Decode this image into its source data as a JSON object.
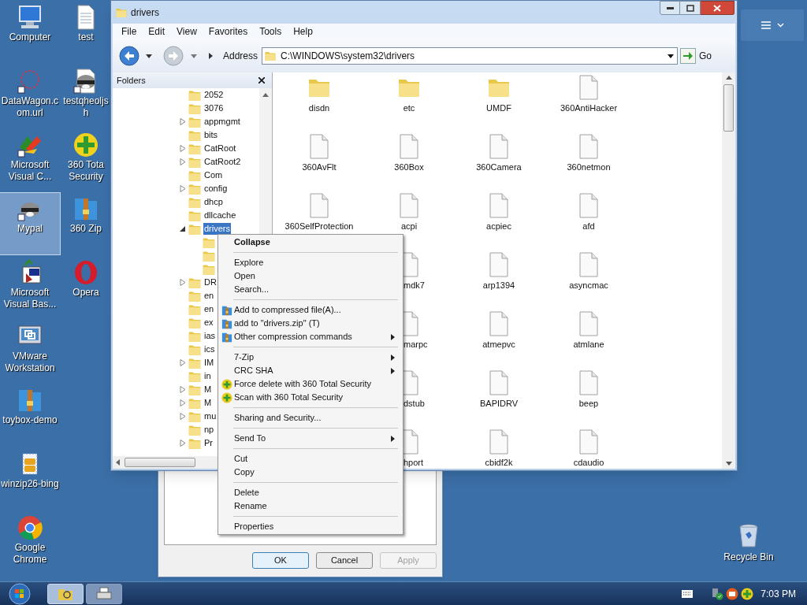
{
  "desktop_icons": [
    {
      "label": "Computer",
      "kind": "computer",
      "selected": false
    },
    {
      "label": "DataWagon.com.url",
      "kind": "web-link",
      "selected": false
    },
    {
      "label": "Microsoft Visual C...",
      "kind": "colorful-app",
      "selected": false
    },
    {
      "label": "Mypal",
      "kind": "raccoon",
      "selected": true
    },
    {
      "label": "Microsoft Visual Bas...",
      "kind": "vb-setup",
      "selected": false
    },
    {
      "label": "VMware Workstation",
      "kind": "vmware",
      "selected": false
    },
    {
      "label": "toybox-demo",
      "kind": "zip-folder",
      "selected": false
    },
    {
      "label": "winzip26-bing",
      "kind": "winzip",
      "selected": false
    },
    {
      "label": "Google Chrome",
      "kind": "chrome",
      "selected": false
    },
    {
      "label": "test",
      "kind": "text-file",
      "selected": false
    },
    {
      "label": "testqheoljsh",
      "kind": "raccoon-file",
      "selected": false
    },
    {
      "label": "360 Tota Security",
      "kind": "plus-shield",
      "selected": false
    },
    {
      "label": "360 Zip",
      "kind": "zip-folder",
      "selected": false
    },
    {
      "label": "Opera",
      "kind": "opera",
      "selected": false
    }
  ],
  "recycle_bin": {
    "label": "Recycle Bin"
  },
  "dialog": {
    "buttons": [
      {
        "label": "OK",
        "default": true,
        "disabled": false
      },
      {
        "label": "Cancel",
        "default": false,
        "disabled": false
      },
      {
        "label": "Apply",
        "default": false,
        "disabled": true
      }
    ]
  },
  "explorer": {
    "title": "drivers",
    "menu": [
      "File",
      "Edit",
      "View",
      "Favorites",
      "Tools",
      "Help"
    ],
    "address_label": "Address",
    "address": "C:\\WINDOWS\\system32\\drivers",
    "go": "Go",
    "folders_title": "Folders",
    "tree": [
      {
        "label": "2052",
        "expandable": false,
        "selected": false
      },
      {
        "label": "3076",
        "expandable": false,
        "selected": false
      },
      {
        "label": "appmgmt",
        "expandable": true,
        "expanded": false,
        "selected": false
      },
      {
        "label": "bits",
        "expandable": false,
        "selected": false
      },
      {
        "label": "CatRoot",
        "expandable": true,
        "expanded": false,
        "selected": false
      },
      {
        "label": "CatRoot2",
        "expandable": true,
        "expanded": false,
        "selected": false
      },
      {
        "label": "Com",
        "expandable": false,
        "selected": false
      },
      {
        "label": "config",
        "expandable": true,
        "expanded": false,
        "selected": false
      },
      {
        "label": "dhcp",
        "expandable": false,
        "selected": false
      },
      {
        "label": "dllcache",
        "expandable": false,
        "selected": false
      },
      {
        "label": "drivers",
        "expandable": true,
        "expanded": true,
        "selected": true,
        "children": [
          {
            "expandable": false,
            "selected": false
          },
          {
            "expandable": false,
            "selected": false
          },
          {
            "expandable": false,
            "selected": false
          }
        ]
      },
      {
        "label": "DR",
        "expandable": true,
        "expanded": false,
        "selected": false
      },
      {
        "label": "en",
        "expandable": false,
        "selected": false
      },
      {
        "label": "en",
        "expandable": false,
        "selected": false
      },
      {
        "label": "ex",
        "expandable": false,
        "selected": false
      },
      {
        "label": "ias",
        "expandable": false,
        "selected": false
      },
      {
        "label": "ics",
        "expandable": false,
        "selected": false
      },
      {
        "label": "IM",
        "expandable": true,
        "expanded": false,
        "selected": false
      },
      {
        "label": "in",
        "expandable": false,
        "selected": false
      },
      {
        "label": "M",
        "expandable": true,
        "expanded": false,
        "selected": false
      },
      {
        "label": "M",
        "expandable": true,
        "expanded": false,
        "selected": false
      },
      {
        "label": "mu",
        "expandable": true,
        "expanded": false,
        "selected": false
      },
      {
        "label": "np",
        "expandable": false,
        "selected": false
      },
      {
        "label": "Pr",
        "expandable": true,
        "expanded": false,
        "selected": false
      }
    ],
    "file_rows": [
      [
        {
          "label": "disdn",
          "kind": "folder",
          "clipped": false
        },
        {
          "label": "etc",
          "kind": "folder",
          "clipped": false
        },
        {
          "label": "UMDF",
          "kind": "folder",
          "clipped": false
        },
        {
          "label": "360AntiHacker",
          "kind": "file",
          "clipped": false
        }
      ],
      [
        {
          "label": "360AvFlt",
          "kind": "file",
          "clipped": false
        },
        {
          "label": "360Box",
          "kind": "file",
          "clipped": false
        },
        {
          "label": "360Camera",
          "kind": "file",
          "clipped": false
        },
        {
          "label": "360netmon",
          "kind": "file",
          "clipped": false
        }
      ],
      [
        {
          "label": "360SelfProtection",
          "kind": "file",
          "clipped": false
        },
        {
          "label": "acpi",
          "kind": "file",
          "clipped": false
        },
        {
          "label": "acpiec",
          "kind": "file",
          "clipped": false
        },
        {
          "label": "afd",
          "kind": "file",
          "clipped": false
        }
      ],
      [
        {
          "label": "mdk7",
          "kind": "file",
          "clipped": true
        },
        {
          "label": "arp1394",
          "kind": "file",
          "clipped": false
        },
        {
          "label": "asyncmac",
          "kind": "file",
          "clipped": false
        }
      ],
      [
        {
          "label": "marpc",
          "kind": "file",
          "clipped": true
        },
        {
          "label": "atmepvc",
          "kind": "file",
          "clipped": false
        },
        {
          "label": "atmlane",
          "kind": "file",
          "clipped": false
        }
      ],
      [
        {
          "label": "dstub",
          "kind": "file",
          "clipped": true
        },
        {
          "label": "BAPIDRV",
          "kind": "file",
          "clipped": false
        },
        {
          "label": "beep",
          "kind": "file",
          "clipped": false
        }
      ],
      [
        {
          "label": "hport",
          "kind": "file",
          "clipped": true
        },
        {
          "label": "cbidf2k",
          "kind": "file",
          "clipped": false
        },
        {
          "label": "cdaudio",
          "kind": "file",
          "clipped": false
        }
      ]
    ]
  },
  "context_menu": [
    {
      "kind": "item",
      "label": "Collapse",
      "default": true,
      "submenu": false
    },
    {
      "kind": "separator"
    },
    {
      "kind": "item",
      "label": "Explore",
      "default": false,
      "submenu": false
    },
    {
      "kind": "item",
      "label": "Open",
      "default": false,
      "submenu": false
    },
    {
      "kind": "item",
      "label": "Search...",
      "default": false,
      "submenu": false
    },
    {
      "kind": "separator"
    },
    {
      "kind": "archive_item",
      "label": "Add to compressed file(A)...",
      "default": false,
      "submenu": false
    },
    {
      "kind": "archive_item",
      "label": "add to \"drivers.zip\" (T)",
      "default": false,
      "submenu": false
    },
    {
      "kind": "archive_item",
      "label": "Other compression commands",
      "default": false,
      "submenu": true
    },
    {
      "kind": "separator"
    },
    {
      "kind": "item",
      "label": "7-Zip",
      "default": false,
      "submenu": true
    },
    {
      "kind": "item",
      "label": "CRC SHA",
      "default": false,
      "submenu": true
    },
    {
      "kind": "security_item",
      "label": "Force delete with 360 Total Security",
      "default": false,
      "submenu": false
    },
    {
      "kind": "security_item",
      "label": "Scan with 360 Total Security",
      "default": false,
      "submenu": false
    },
    {
      "kind": "separator"
    },
    {
      "kind": "item",
      "label": "Sharing and Security...",
      "default": false,
      "submenu": false
    },
    {
      "kind": "separator"
    },
    {
      "kind": "item",
      "label": "Send To",
      "default": false,
      "submenu": true
    },
    {
      "kind": "separator"
    },
    {
      "kind": "item",
      "label": "Cut",
      "default": false,
      "submenu": false
    },
    {
      "kind": "item",
      "label": "Copy",
      "default": false,
      "submenu": false
    },
    {
      "kind": "separator"
    },
    {
      "kind": "item",
      "label": "Delete",
      "default": false,
      "submenu": false
    },
    {
      "kind": "item",
      "label": "Rename",
      "default": false,
      "submenu": false
    },
    {
      "kind": "separator"
    },
    {
      "kind": "item",
      "label": "Properties",
      "default": false,
      "submenu": false
    }
  ],
  "taskbar": {
    "tasks": [
      {
        "kind": "explorer",
        "selected": true
      },
      {
        "kind": "printer",
        "selected": false
      }
    ],
    "clock": "7:03 PM"
  }
}
